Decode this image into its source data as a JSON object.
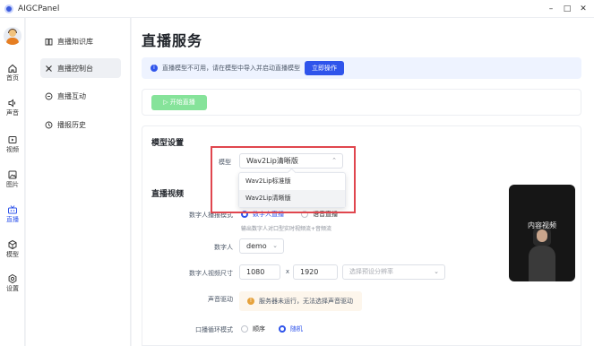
{
  "app": {
    "title": "AIGCPanel"
  },
  "window_controls": {
    "minimize": "–",
    "maximize": "□",
    "close": "✕"
  },
  "rail": {
    "items": [
      {
        "label": "首页",
        "icon": "home-icon"
      },
      {
        "label": "声音",
        "icon": "sound-icon"
      },
      {
        "label": "视频",
        "icon": "video-icon"
      },
      {
        "label": "图片",
        "icon": "image-icon"
      },
      {
        "label": "直播",
        "icon": "live-icon",
        "active": true
      },
      {
        "label": "模型",
        "icon": "model-icon"
      },
      {
        "label": "设置",
        "icon": "settings-icon"
      }
    ]
  },
  "sidebar": {
    "items": [
      {
        "label": "直播知识库",
        "icon": "book-icon"
      },
      {
        "label": "直播控制台",
        "icon": "console-icon",
        "active": true
      },
      {
        "label": "直播互动",
        "icon": "chat-icon"
      },
      {
        "label": "播报历史",
        "icon": "history-icon"
      }
    ]
  },
  "main": {
    "title": "直播服务",
    "notice": {
      "message": "直播模型不可用，请在模型中导入并启动直播模型",
      "action": "立即操作"
    },
    "start_button": "▷ 开始直播",
    "model_settings": {
      "title": "模型设置",
      "model_label": "模型",
      "model_value": "Wav2Lip清晰版",
      "options": [
        "Wav2Lip标准版",
        "Wav2Lip清晰版"
      ]
    },
    "live_video": {
      "title": "直播视频",
      "mode_label": "数字人播报模式",
      "mode_options": [
        "数字人直播",
        "语音直播"
      ],
      "mode_hint": "输出数字人对口型实时视频流+音频流",
      "person_label": "数字人",
      "person_value": "demo",
      "size_label": "数字人视频尺寸",
      "width": "1080",
      "times": "x",
      "height": "1920",
      "preset_placeholder": "选择预设分辨率",
      "voice_label": "声音驱动",
      "voice_warning": "服务器未运行，无法选择声音驱动",
      "loop_label": "口播循环模式",
      "loop_options": [
        "顺序",
        "随机"
      ],
      "preview_label": "内容视频"
    }
  },
  "colors": {
    "accent": "#2f54eb",
    "success_light": "#86e39a",
    "highlight": "#e0464e",
    "warning": "#e6a23c"
  }
}
